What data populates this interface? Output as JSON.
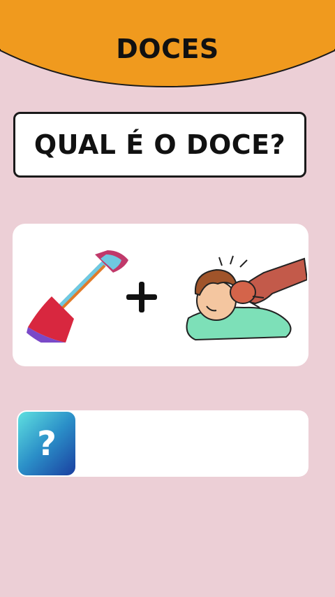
{
  "header": {
    "title": "DOCES",
    "color": "#f09a1e"
  },
  "question": {
    "text": "QUAL É O DOCE?"
  },
  "puzzle": {
    "items": [
      "shovel-icon",
      "plus-icon",
      "punch-icon"
    ],
    "operator": "+"
  },
  "answer": {
    "hint_icon": "question-mark-icon",
    "hint_symbol": "?",
    "value": ""
  }
}
